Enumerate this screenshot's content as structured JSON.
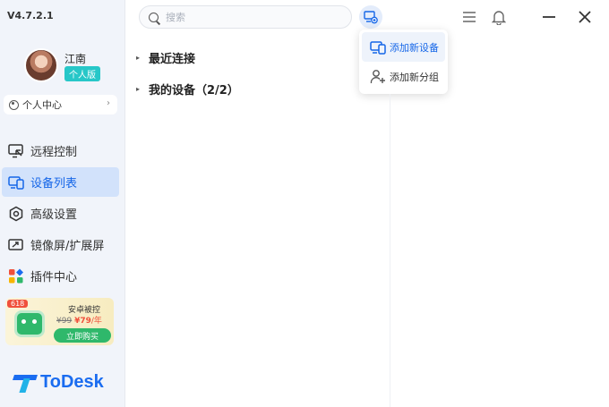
{
  "app": {
    "version": "V4.7.2.1",
    "brand": "ToDesk",
    "accent": "#1566e8"
  },
  "user": {
    "name": "江南",
    "plan_badge": "个人版",
    "center_label": "个人中心",
    "center_chevron": "›"
  },
  "nav": [
    {
      "label": "远程控制",
      "icon": "remote-control-icon",
      "active": false
    },
    {
      "label": "设备列表",
      "icon": "devices-icon",
      "active": true
    },
    {
      "label": "高级设置",
      "icon": "settings-hexagon-icon",
      "active": false
    },
    {
      "label": "镜像屏/扩展屏",
      "icon": "mirror-screen-icon",
      "active": false
    },
    {
      "label": "插件中心",
      "icon": "plugin-grid-icon",
      "active": false
    }
  ],
  "promo": {
    "tag": "618",
    "title": "安卓被控",
    "old_price": "¥99",
    "price": "¥79",
    "unit": "/年",
    "button": "立即购买"
  },
  "search": {
    "placeholder": "搜索"
  },
  "dropdown": [
    {
      "label": "添加新设备",
      "icon": "add-device-icon",
      "highlighted": true
    },
    {
      "label": "添加新分组",
      "icon": "add-group-icon",
      "highlighted": false
    }
  ],
  "tree": [
    {
      "label": "最近连接",
      "arrow": "▸"
    },
    {
      "label": "我的设备（2/2）",
      "arrow": "▸"
    }
  ],
  "window_controls": [
    "menu-icon",
    "bell-icon",
    "minimize-icon",
    "close-icon"
  ]
}
